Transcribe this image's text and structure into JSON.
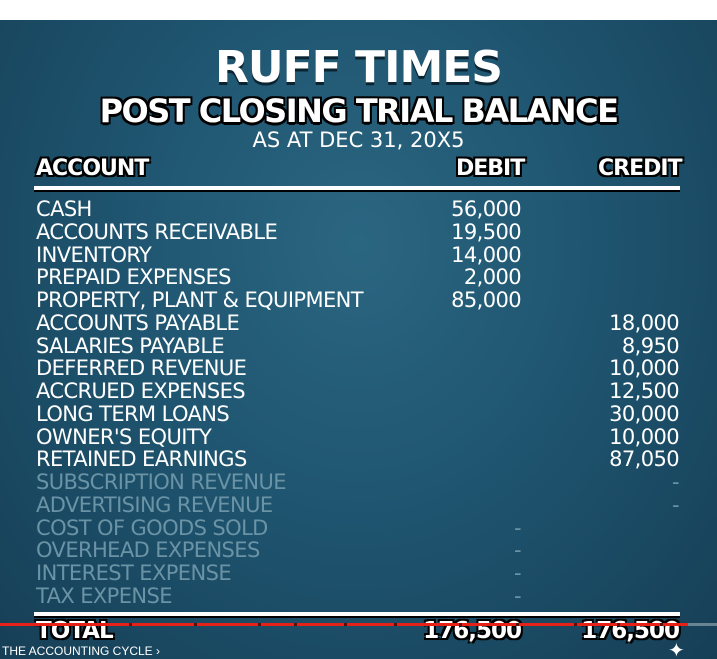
{
  "header": {
    "company": "RUFF TIMES",
    "statement": "POST CLOSING TRIAL BALANCE",
    "date": "AS AT DEC 31, 20X5"
  },
  "columns": {
    "account": "ACCOUNT",
    "debit": "DEBIT",
    "credit": "CREDIT"
  },
  "rows": [
    {
      "account": "CASH",
      "debit": "56,000",
      "credit": "",
      "style": "active"
    },
    {
      "account": "ACCOUNTS RECEIVABLE",
      "debit": "19,500",
      "credit": "",
      "style": "active"
    },
    {
      "account": "INVENTORY",
      "debit": "14,000",
      "credit": "",
      "style": "active"
    },
    {
      "account": "PREPAID EXPENSES",
      "debit": "2,000",
      "credit": "",
      "style": "active"
    },
    {
      "account": "PROPERTY, PLANT & EQUIPMENT",
      "debit": "85,000",
      "credit": "",
      "style": "active"
    },
    {
      "account": "ACCOUNTS PAYABLE",
      "debit": "",
      "credit": "18,000",
      "style": "active"
    },
    {
      "account": "SALARIES PAYABLE",
      "debit": "",
      "credit": "8,950",
      "style": "active"
    },
    {
      "account": "DEFERRED REVENUE",
      "debit": "",
      "credit": "10,000",
      "style": "active"
    },
    {
      "account": "ACCRUED EXPENSES",
      "debit": "",
      "credit": "12,500",
      "style": "active"
    },
    {
      "account": "LONG TERM LOANS",
      "debit": "",
      "credit": "30,000",
      "style": "active"
    },
    {
      "account": "OWNER'S EQUITY",
      "debit": "",
      "credit": "10,000",
      "style": "active"
    },
    {
      "account": "RETAINED EARNINGS",
      "debit": "",
      "credit": "87,050",
      "style": "active"
    },
    {
      "account": "SUBSCRIPTION REVENUE",
      "debit": "",
      "credit": "-",
      "style": "dim"
    },
    {
      "account": "ADVERTISING REVENUE",
      "debit": "",
      "credit": "-",
      "style": "dim"
    },
    {
      "account": "COST OF GOODS SOLD",
      "debit": "-",
      "credit": "",
      "style": "dim"
    },
    {
      "account": "OVERHEAD EXPENSES",
      "debit": "-",
      "credit": "",
      "style": "dim"
    },
    {
      "account": "INTEREST EXPENSE",
      "debit": "-",
      "credit": "",
      "style": "dim"
    },
    {
      "account": "TAX EXPENSE",
      "debit": "-",
      "credit": "",
      "style": "dim"
    }
  ],
  "totals": {
    "label": "TOTAL",
    "debit": "176,500",
    "credit": "176,500"
  },
  "player": {
    "chapter_title": "THE ACCOUNTING CYCLE",
    "chapter_arrow": "›",
    "progress_fraction": 0.96,
    "progress_color": "#e62117"
  },
  "colors": {
    "background": "#1f5570",
    "dim_text": "#6b93a6"
  }
}
